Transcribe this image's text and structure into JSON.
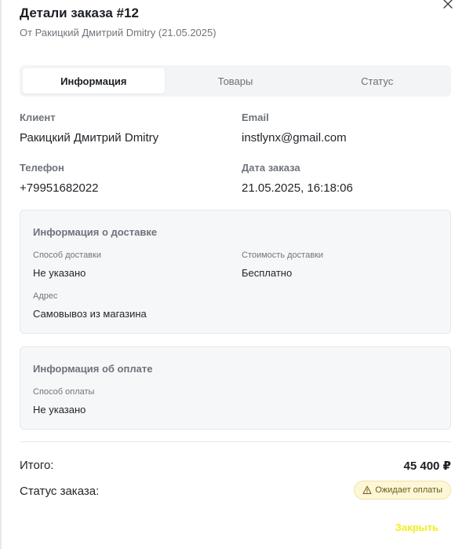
{
  "dialog": {
    "title": "Детали заказа #12",
    "subtitle": "От Ракицкий Дмитрий Dmitry (21.05.2025)",
    "close_icon": "close-icon"
  },
  "tabs": [
    {
      "label": "Информация",
      "active": true
    },
    {
      "label": "Товары",
      "active": false
    },
    {
      "label": "Статус",
      "active": false
    }
  ],
  "client": {
    "label": "Клиент",
    "value": "Ракицкий Дмитрий Dmitry"
  },
  "email": {
    "label": "Email",
    "value": "instlynx@gmail.com"
  },
  "phone": {
    "label": "Телефон",
    "value": "+79951682022"
  },
  "order_date": {
    "label": "Дата заказа",
    "value": "21.05.2025, 16:18:06"
  },
  "delivery": {
    "title": "Информация о доставке",
    "method_label": "Способ доставки",
    "method_value": "Не указано",
    "cost_label": "Стоимость доставки",
    "cost_value": "Бесплатно",
    "address_label": "Адрес",
    "address_value": "Самовывоз из магазина"
  },
  "payment": {
    "title": "Информация об оплате",
    "method_label": "Способ оплаты",
    "method_value": "Не указано"
  },
  "summary": {
    "total_label": "Итого:",
    "total_value": "45 400 ₽",
    "status_label": "Статус заказа:",
    "status_value": "Ожидает оплаты",
    "status_icon": "warning-icon",
    "status_color": "#fdf7d8"
  },
  "footer": {
    "close_label": "Закрыть",
    "close_color": "#f2ee1a"
  }
}
